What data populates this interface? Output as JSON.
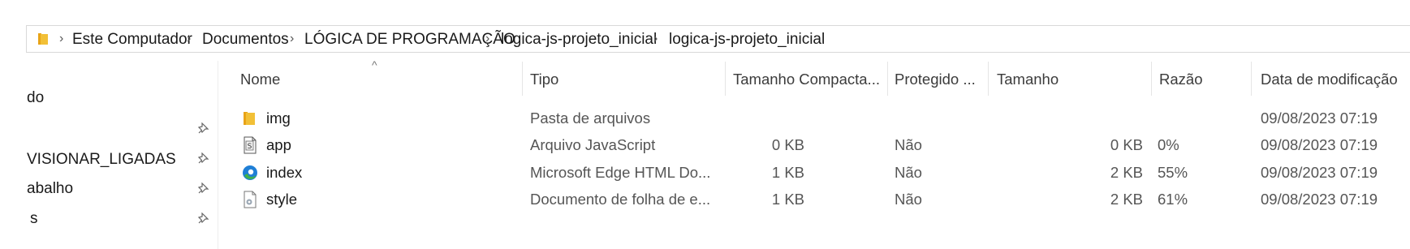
{
  "address_bar": {
    "crumbs": [
      "Este Computador",
      "Documentos",
      "LÓGICA DE PROGRAMAÇÃO",
      "logica-js-projeto_inicial",
      "logica-js-projeto_inicial"
    ]
  },
  "nav_pane": {
    "items": [
      {
        "label": "do",
        "pinned": false
      },
      {
        "label": "",
        "pinned": true
      },
      {
        "label": "VISIONAR_LIGADAS",
        "pinned": true
      },
      {
        "label": "abalho",
        "pinned": true
      },
      {
        "label": "s",
        "pinned": true
      }
    ]
  },
  "columns": {
    "name": "Nome",
    "type": "Tipo",
    "compressed_size": "Tamanho Compacta...",
    "protected": "Protegido ...",
    "size": "Tamanho",
    "ratio": "Razão",
    "modified": "Data de modificação"
  },
  "files": [
    {
      "name": "img",
      "icon": "folder-icon",
      "type": "Pasta de arquivos",
      "compressed_size": "",
      "protected": "",
      "size": "",
      "ratio": "",
      "modified": "09/08/2023 07:19"
    },
    {
      "name": "app",
      "icon": "javascript-file-icon",
      "type": "Arquivo JavaScript",
      "compressed_size": "0 KB",
      "protected": "Não",
      "size": "0 KB",
      "ratio": "0%",
      "modified": "09/08/2023 07:19"
    },
    {
      "name": "index",
      "icon": "edge-html-file-icon",
      "type": "Microsoft Edge HTML Do...",
      "compressed_size": "1 KB",
      "protected": "Não",
      "size": "2 KB",
      "ratio": "55%",
      "modified": "09/08/2023 07:19"
    },
    {
      "name": "style",
      "icon": "css-file-icon",
      "type": "Documento de folha de e...",
      "compressed_size": "1 KB",
      "protected": "Não",
      "size": "2 KB",
      "ratio": "61%",
      "modified": "09/08/2023 07:19"
    }
  ],
  "colors": {
    "folder": "#f2c037",
    "edge_blue": "#1f7fd6",
    "edge_green": "#3fb24a",
    "divider": "#e5e5e5",
    "text": "#1a1a1a",
    "secondary_text": "#555555"
  }
}
